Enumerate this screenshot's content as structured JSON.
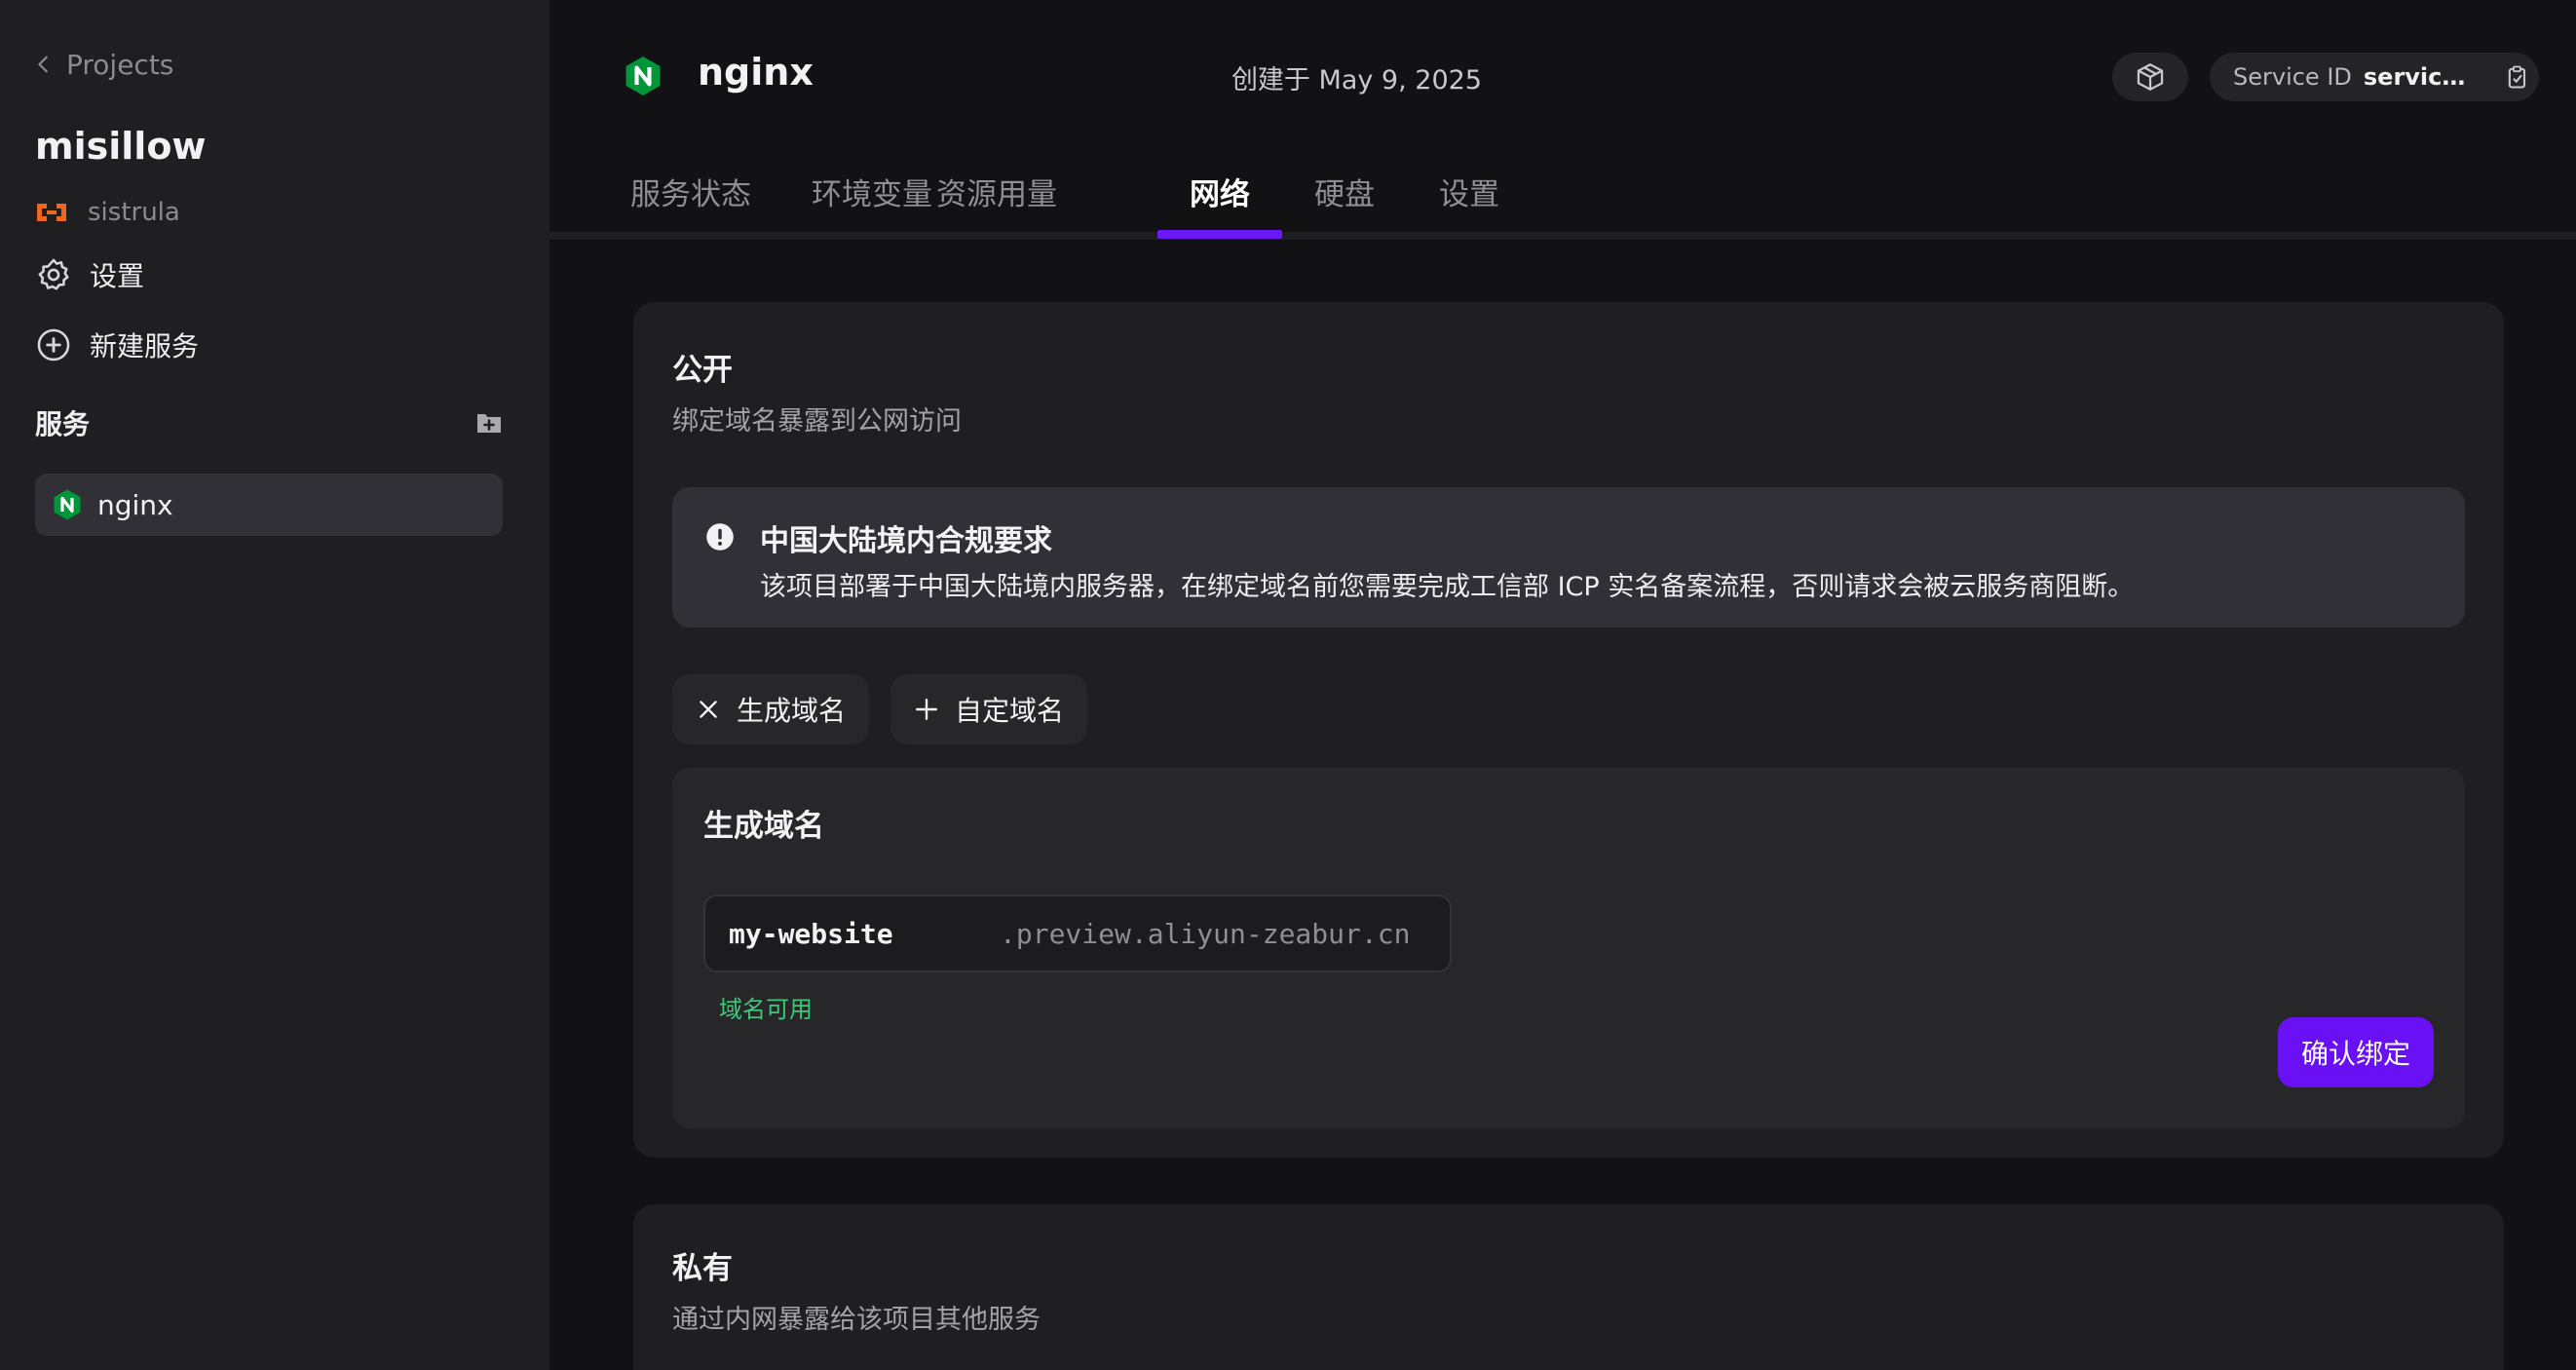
{
  "sidebar": {
    "back_label": "Projects",
    "project_name": "misillow",
    "team_name": "sistrula",
    "settings_label": "设置",
    "new_service_label": "新建服务",
    "services_heading": "服务",
    "services": [
      {
        "name": "nginx"
      }
    ]
  },
  "header": {
    "service_name": "nginx",
    "created_label": "创建于",
    "created_date": "May 9, 2025",
    "service_id_label": "Service ID",
    "service_id_value": "service-…"
  },
  "tabs": [
    {
      "label": "服务状态"
    },
    {
      "label": "环境变量"
    },
    {
      "label": "资源用量"
    },
    {
      "label": "网络"
    },
    {
      "label": "硬盘"
    },
    {
      "label": "设置"
    }
  ],
  "active_tab": "网络",
  "public": {
    "title": "公开",
    "description": "绑定域名暴露到公网访问",
    "notice_title": "中国大陆境内合规要求",
    "notice_body": "该项目部署于中国大陆境内服务器，在绑定域名前您需要完成工信部 ICP 实名备案流程，否则请求会被云服务商阻断。",
    "generate_chip_label": "生成域名",
    "custom_chip_label": "自定域名",
    "generate_section_title": "生成域名",
    "domain_input_value": "my-website",
    "domain_suffix": ".preview.aliyun-zeabur.cn",
    "availability_text": "域名可用",
    "confirm_button_label": "确认绑定"
  },
  "private": {
    "title": "私有",
    "description": "通过内网暴露给该项目其他服务"
  },
  "colors": {
    "accent": "#6a10f5",
    "success": "#3ec87a",
    "nginx_green": "#009639",
    "team_orange": "#f0651f"
  }
}
